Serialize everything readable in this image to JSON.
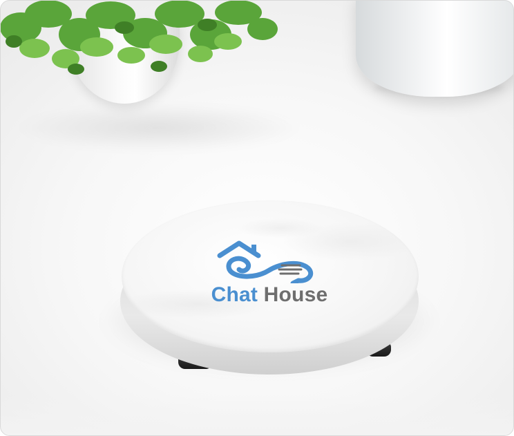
{
  "logo": {
    "word_primary": "Chat",
    "word_secondary": "House",
    "primary_color": "#4a8fd0",
    "secondary_color": "#6e6e6e",
    "mark_icon": "house-chat-bubble-icon"
  },
  "scene": {
    "objects": [
      "white-marble-round-tray",
      "potted-plant",
      "white-ceramic-pot"
    ]
  }
}
